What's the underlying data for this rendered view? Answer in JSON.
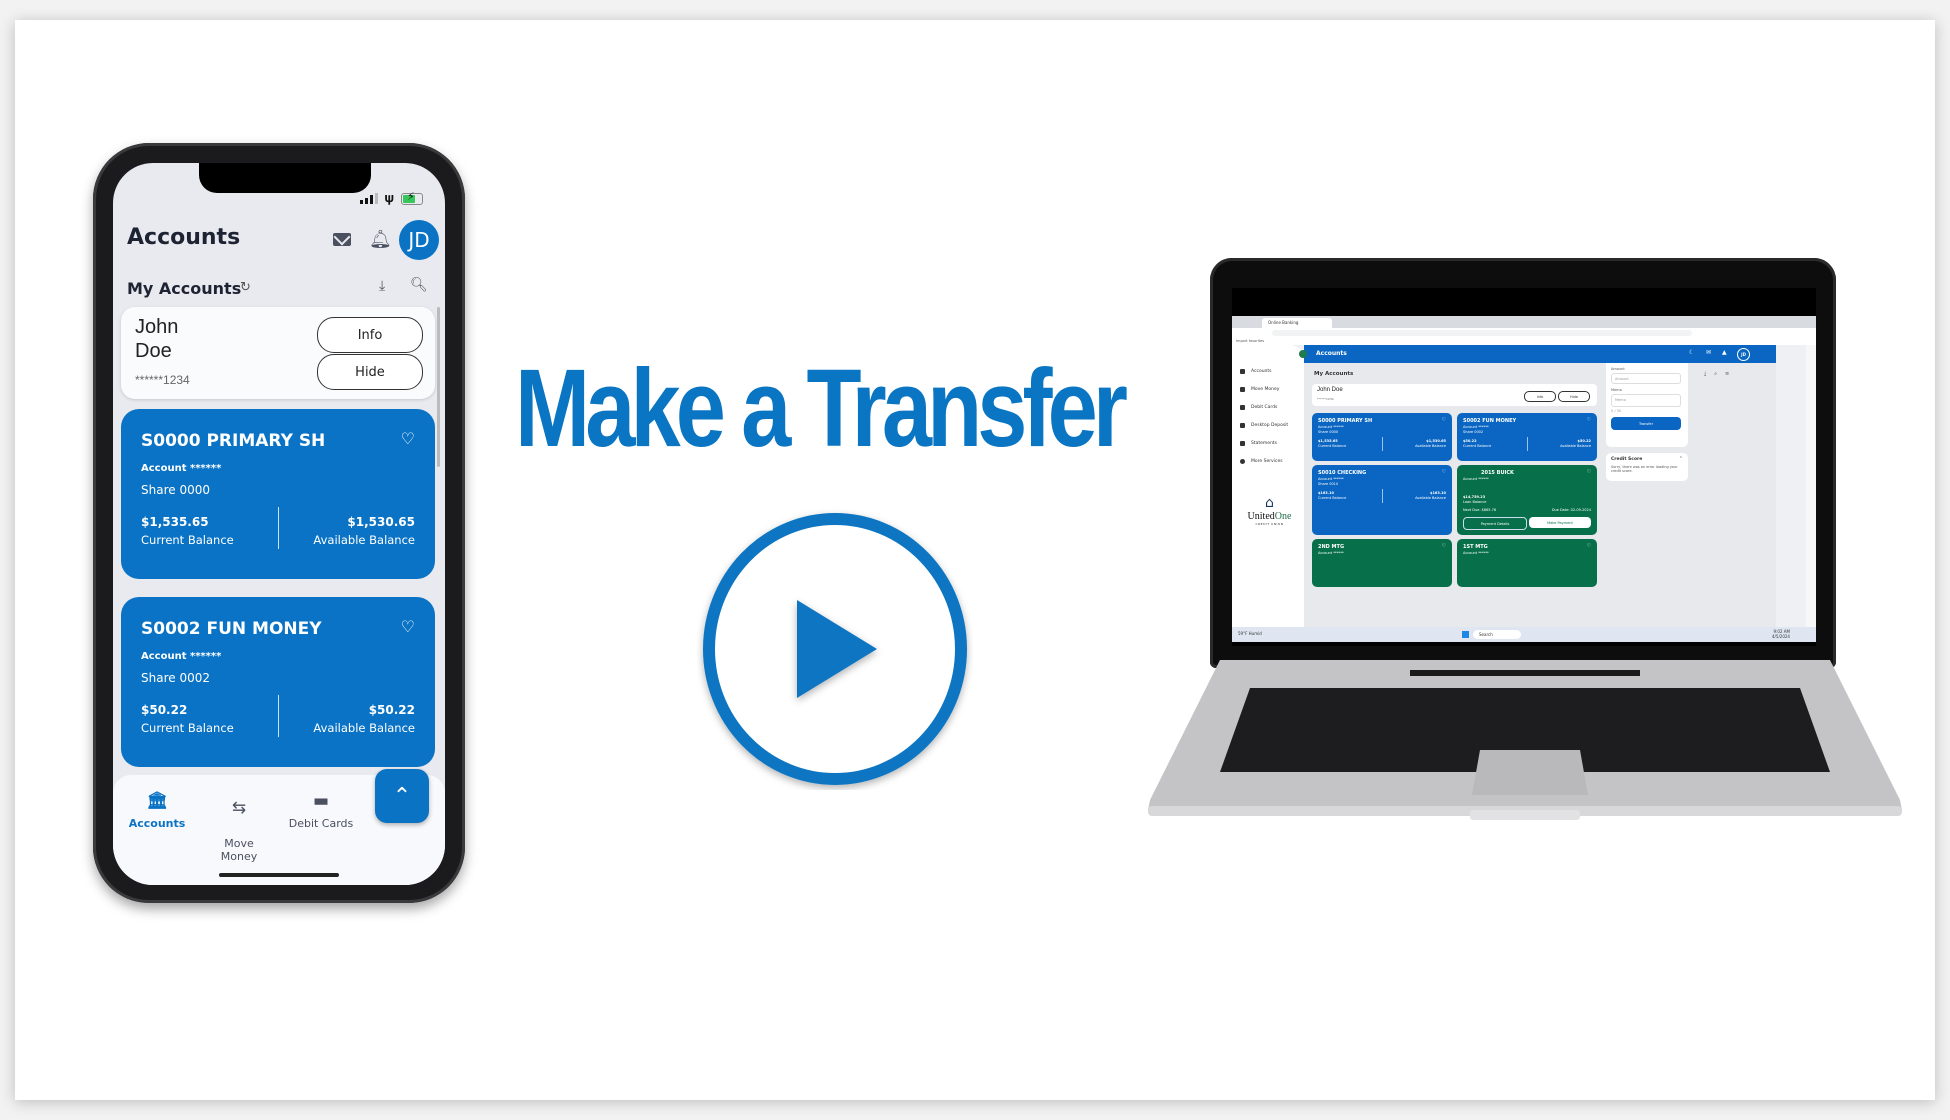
{
  "headline": "Make a Transfer",
  "play_button": {
    "label": "Play video",
    "icon": "play-icon",
    "color": "#0a75c2"
  },
  "colors": {
    "brand_blue": "#0a73c5",
    "brand_green": "#07704a",
    "headline_blue": "#0a75c2"
  },
  "phone": {
    "status": {
      "signal": "signal-icon",
      "wifi": "wifi-icon",
      "battery": "battery-charging-icon"
    },
    "header": {
      "title": "Accounts",
      "mail_icon": "mail-icon",
      "bell_icon": "bell-icon",
      "avatar": "JD"
    },
    "subheader": {
      "title": "My Accounts",
      "refresh_icon": "refresh-icon",
      "download_icon": "download-icon",
      "search_icon": "search-icon"
    },
    "user": {
      "first_name": "John",
      "last_name": "Doe",
      "masked": "******1234",
      "info_label": "Info",
      "hide_label": "Hide"
    },
    "accounts": [
      {
        "name": "S0000 PRIMARY SH",
        "account": "Account ******",
        "share": "Share 0000",
        "current": "$1,535.65",
        "current_label": "Current Balance",
        "available": "$1,530.65",
        "available_label": "Available Balance"
      },
      {
        "name": "S0002 FUN MONEY",
        "account": "Account ******",
        "share": "Share 0002",
        "current": "$50.22",
        "current_label": "Current Balance",
        "available": "$50.22",
        "available_label": "Available Balance"
      }
    ],
    "nav": [
      {
        "label": "Accounts",
        "icon": "bank-icon",
        "active": true
      },
      {
        "label": "Move\nMoney",
        "icon": "transfer-arrows-icon",
        "active": false
      },
      {
        "label": "Debit Cards",
        "icon": "credit-card-icon",
        "active": false
      }
    ],
    "fab_icon": "chevron-double-up-icon"
  },
  "laptop": {
    "browser": {
      "tab_title": "Online Banking",
      "bookmarks": "Import favorites"
    },
    "sidebar": {
      "items": [
        "Accounts",
        "Move Money",
        "Debit Cards",
        "Desktop Deposit",
        "Statements",
        "More Services"
      ],
      "logo_main": "United",
      "logo_accent": "One",
      "logo_sub": "CREDIT UNION"
    },
    "header": {
      "title": "Accounts",
      "avatar": "JD"
    },
    "my_accounts": "My Accounts",
    "user": {
      "name": "John Doe",
      "masked": "******1234",
      "info_label": "Info",
      "hide_label": "Hide"
    },
    "accounts": [
      {
        "name": "S0000 PRIMARY SH",
        "account": "Account ******",
        "share": "Share 0000",
        "current": "$1,535.65",
        "current_label": "Current Balance",
        "available": "$1,530.65",
        "available_label": "Available Balance"
      },
      {
        "name": "S0002 FUN MONEY",
        "account": "Account ******",
        "share": "Share 0002",
        "current": "$50.22",
        "current_label": "Current Balance",
        "available": "$50.22",
        "available_label": "Available Balance"
      },
      {
        "name": "S0010 CHECKING",
        "account": "Account ******",
        "share": "Share 0010",
        "current": "$163.10",
        "current_label": "Current Balance",
        "available": "$163.10",
        "available_label": "Available Balance"
      }
    ],
    "loan": {
      "name": "2015 BUICK",
      "account": "Account ******",
      "balance": "$14,759.23",
      "balance_label": "Loan Balance",
      "next_due": "Next Due: $865.76",
      "due_date": "Due Date: 02-09-2024",
      "details_label": "Payment Details",
      "pay_label": "Make Payment"
    },
    "mortgages": [
      {
        "name": "2ND MTG",
        "account": "Account ******"
      },
      {
        "name": "1ST MTG",
        "account": "Account ******"
      }
    ],
    "transfer_panel": {
      "amount_label": "Amount",
      "amount_placeholder": "Amount",
      "memo_label": "Memo",
      "memo_placeholder": "Memo",
      "memo_count": "0 / 30",
      "button": "Transfer"
    },
    "credit_score": {
      "title": "Credit Score",
      "message": "Sorry, there was an error loading your credit score."
    },
    "taskbar": {
      "weather": "59°F Humid",
      "search": "Search",
      "time": "9:02 AM",
      "date": "4/5/2024"
    }
  }
}
